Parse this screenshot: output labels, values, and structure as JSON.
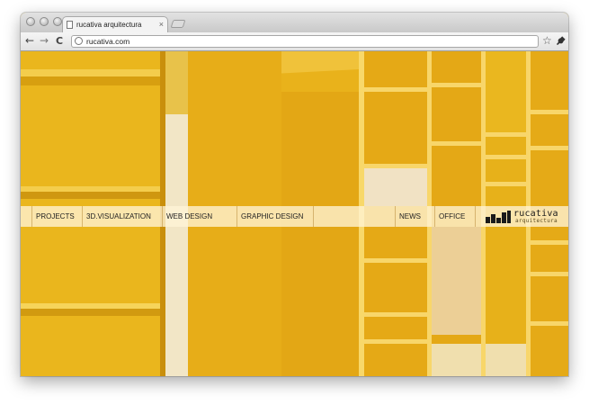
{
  "browser": {
    "tab_title": "rucativa arquitectura",
    "tab_close": "×",
    "url": "rucativa.com",
    "back_icon": "←",
    "forward_icon": "→",
    "reload_icon": "C",
    "star_icon": "☆",
    "wrench_icon": "🔧"
  },
  "nav": {
    "items": [
      {
        "label": "PROJECTS"
      },
      {
        "label": "3D.VISUALIZATION"
      },
      {
        "label": "WEB DESIGN"
      },
      {
        "label": "GRAPHIC DESIGN"
      },
      {
        "label": "NEWS"
      },
      {
        "label": "OFFICE"
      }
    ]
  },
  "logo": {
    "name": "rucativa",
    "subtitle": "arquitectura"
  },
  "colors": {
    "shelf_yellow": "#e9b81c",
    "navbar_tint": "#fff3d6"
  }
}
